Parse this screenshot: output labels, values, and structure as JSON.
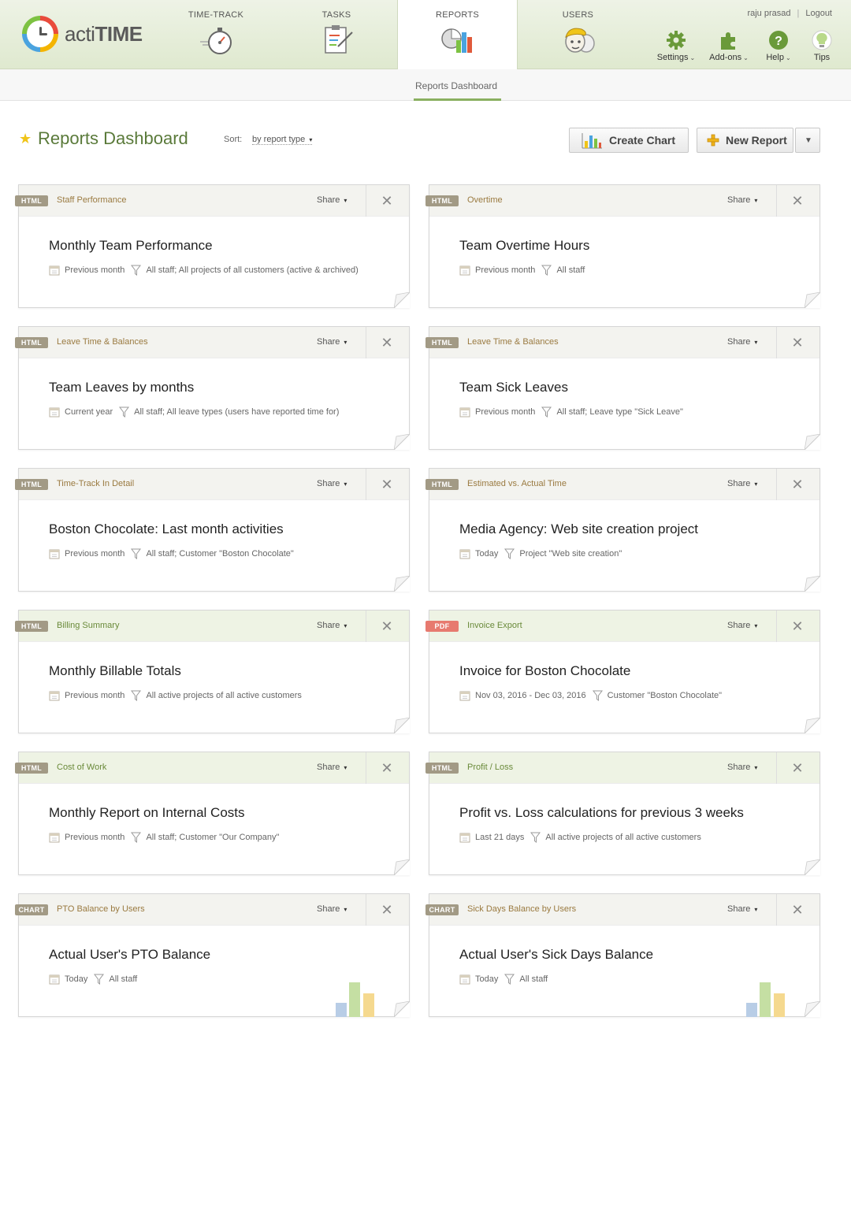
{
  "app": {
    "name_light": "acti",
    "name_bold": "TIME"
  },
  "nav": {
    "tabs": [
      {
        "label": "TIME-TRACK"
      },
      {
        "label": "TASKS"
      },
      {
        "label": "REPORTS"
      },
      {
        "label": "USERS"
      }
    ],
    "active_tab": "REPORTS"
  },
  "user": {
    "name": "raju prasad",
    "separator": "|",
    "logout": "Logout"
  },
  "tools": [
    {
      "label": "Settings",
      "icon": "gear-icon"
    },
    {
      "label": "Add-ons",
      "icon": "puzzle-icon"
    },
    {
      "label": "Help",
      "icon": "help-icon"
    },
    {
      "label": "Tips",
      "icon": "lightbulb-icon"
    }
  ],
  "subnav": {
    "label": "Reports Dashboard"
  },
  "page": {
    "title": "Reports Dashboard",
    "sort_label": "Sort:",
    "sort_value": "by report type",
    "create_chart": "Create Chart",
    "new_report": "New Report"
  },
  "share_label": "Share",
  "cards": [
    {
      "badge": "HTML",
      "type": "Staff Performance",
      "title": "Monthly Team Performance",
      "period": "Previous month",
      "filter": "All staff; All projects of all customers (active & archived)",
      "tone": "tan"
    },
    {
      "badge": "HTML",
      "type": "Overtime",
      "title": "Team Overtime Hours",
      "period": "Previous month",
      "filter": "All staff",
      "tone": "tan"
    },
    {
      "badge": "HTML",
      "type": "Leave Time & Balances",
      "title": "Team Leaves by months",
      "period": "Current year",
      "filter": "All staff; All leave types (users have reported time for)",
      "tone": "tan"
    },
    {
      "badge": "HTML",
      "type": "Leave Time & Balances",
      "title": "Team Sick Leaves",
      "period": "Previous month",
      "filter": "All staff; Leave type \"Sick Leave\"",
      "tone": "tan"
    },
    {
      "badge": "HTML",
      "type": "Time-Track In Detail",
      "title": "Boston Chocolate: Last month activities",
      "period": "Previous month",
      "filter": "All staff; Customer \"Boston Chocolate\"",
      "tone": "tan"
    },
    {
      "badge": "HTML",
      "type": "Estimated vs. Actual Time",
      "title": "Media Agency: Web site creation project",
      "period": "Today",
      "filter": "Project \"Web site creation\"",
      "tone": "tan"
    },
    {
      "badge": "HTML",
      "type": "Billing Summary",
      "title": "Monthly Billable Totals",
      "period": "Previous month",
      "filter": "All active projects of all active customers",
      "tone": "green"
    },
    {
      "badge": "PDF",
      "type": "Invoice Export",
      "title": "Invoice for Boston Chocolate",
      "period": "Nov 03, 2016 - Dec 03, 2016",
      "filter": "Customer \"Boston Chocolate\"",
      "tone": "green"
    },
    {
      "badge": "HTML",
      "type": "Cost of Work",
      "title": "Monthly Report on Internal Costs",
      "period": "Previous month",
      "filter": "All staff; Customer \"Our Company\"",
      "tone": "green"
    },
    {
      "badge": "HTML",
      "type": "Profit / Loss",
      "title": "Profit vs. Loss calculations for previous 3 weeks",
      "period": "Last 21 days",
      "filter": "All active projects of all active customers",
      "tone": "green"
    },
    {
      "badge": "CHART",
      "type": "PTO Balance by Users",
      "title": "Actual User's PTO Balance",
      "period": "Today",
      "filter": "All staff",
      "tone": "tan",
      "chart": true
    },
    {
      "badge": "CHART",
      "type": "Sick Days Balance by Users",
      "title": "Actual User's Sick Days Balance",
      "period": "Today",
      "filter": "All staff",
      "tone": "tan",
      "chart": true
    }
  ],
  "colors": {
    "accent": "#5a7a3a",
    "pdf_badge": "#e77a6f",
    "badge": "#a29a85",
    "chart_blue": "#b8cde6",
    "chart_green": "#c5dfa3",
    "chart_yellow": "#f5d98f"
  }
}
